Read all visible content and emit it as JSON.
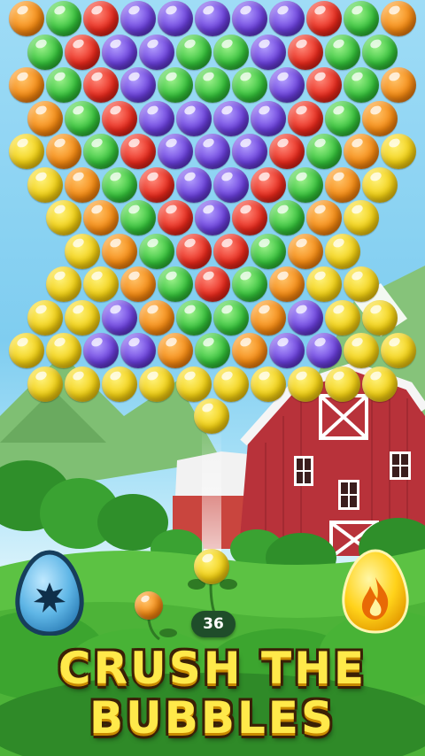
{
  "game": {
    "shots_remaining": "36",
    "headline_line1": "CRUSH THE",
    "headline_line2": "BUBBLES"
  },
  "colors": {
    "yellow": "#f1cf12",
    "orange": "#f58a12",
    "red": "#e8291c",
    "green": "#34c13a",
    "purple": "#6a3fdc",
    "headline_fill": "#ffe94a",
    "headline_outline": "#3b2006",
    "barn_red": "#b8323a"
  },
  "board": {
    "rows": [
      [
        "orange",
        "green",
        "red",
        "purple",
        "purple",
        "purple",
        "purple",
        "purple",
        "red",
        "green",
        "orange"
      ],
      [
        "green",
        "red",
        "purple",
        "purple",
        "green",
        "green",
        "purple",
        "red",
        "green",
        "green"
      ],
      [
        "orange",
        "green",
        "red",
        "purple",
        "green",
        "green",
        "green",
        "purple",
        "red",
        "green",
        "orange"
      ],
      [
        "orange",
        "green",
        "red",
        "purple",
        "purple",
        "purple",
        "purple",
        "red",
        "green",
        "orange"
      ],
      [
        "yellow",
        "orange",
        "green",
        "red",
        "purple",
        "purple",
        "purple",
        "red",
        "green",
        "orange",
        "yellow"
      ],
      [
        "yellow",
        "orange",
        "green",
        "red",
        "purple",
        "purple",
        "red",
        "green",
        "orange",
        "yellow"
      ],
      [
        "yellow",
        "orange",
        "green",
        "red",
        "purple",
        "red",
        "green",
        "orange",
        "yellow"
      ],
      [
        "yellow",
        "orange",
        "green",
        "red",
        "red",
        "green",
        "orange",
        "yellow"
      ],
      [
        "yellow",
        "yellow",
        "orange",
        "green",
        "red",
        "green",
        "orange",
        "yellow",
        "yellow"
      ],
      [
        "yellow",
        "yellow",
        "purple",
        "orange",
        "green",
        "green",
        "orange",
        "purple",
        "yellow",
        "yellow"
      ],
      [
        "yellow",
        "yellow",
        "purple",
        "purple",
        "orange",
        "green",
        "orange",
        "purple",
        "purple",
        "yellow",
        "yellow"
      ],
      [
        "yellow",
        "yellow",
        "yellow",
        "yellow",
        "yellow",
        "yellow",
        "yellow",
        "yellow",
        "yellow",
        "yellow"
      ]
    ],
    "shooter_color": "yellow",
    "next_color": "orange",
    "flying_color": "yellow"
  },
  "boosters": {
    "left_icon": "bomb-star-icon",
    "right_icon": "fire-icon"
  }
}
